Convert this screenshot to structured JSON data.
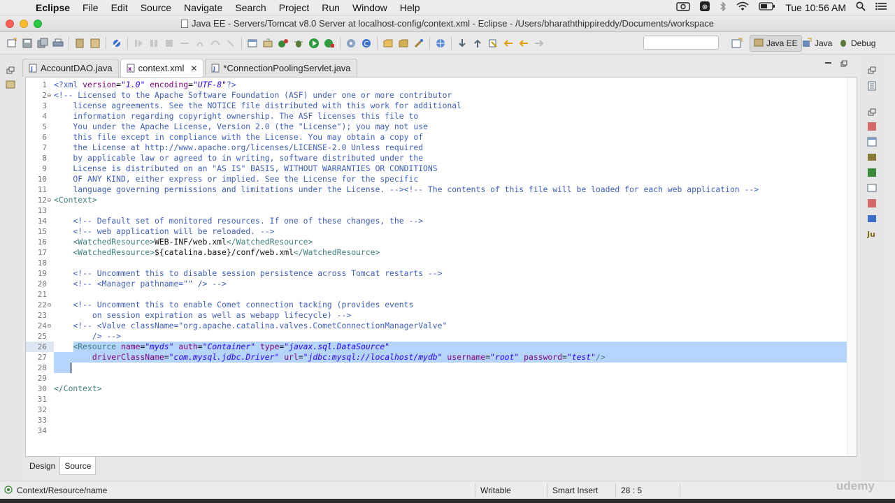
{
  "menubar": {
    "app": "Eclipse",
    "items": [
      "File",
      "Edit",
      "Source",
      "Navigate",
      "Search",
      "Project",
      "Run",
      "Window",
      "Help"
    ],
    "clock": "Tue 10:56 AM"
  },
  "window": {
    "title": "Java EE - Servers/Tomcat v8.0 Server at localhost-config/context.xml - Eclipse - /Users/bharaththippireddy/Documents/workspace"
  },
  "toolbar": {
    "quick_access_placeholder": "",
    "perspectives": [
      "Java EE",
      "Java",
      "Debug"
    ]
  },
  "tabs": [
    {
      "label": "AccountDAO.java",
      "icon": "java-file-icon",
      "active": false
    },
    {
      "label": "context.xml",
      "icon": "xml-file-icon",
      "active": true
    },
    {
      "label": "*ConnectionPoolingServlet.java",
      "icon": "java-file-icon",
      "active": false
    }
  ],
  "editor": {
    "line_numbers": [
      "1",
      "2",
      "3",
      "4",
      "5",
      "6",
      "7",
      "8",
      "9",
      "10",
      "11",
      "12",
      "13",
      "14",
      "15",
      "16",
      "17",
      "18",
      "19",
      "20",
      "21",
      "22",
      "23",
      "24",
      "25",
      "26",
      "27",
      "28",
      "29",
      "30",
      "31",
      "32",
      "33",
      "34"
    ],
    "lines": [
      "<?xml version=\"1.0\" encoding=\"UTF-8\"?>",
      "<!-- Licensed to the Apache Software Foundation (ASF) under one or more contributor",
      "    license agreements. See the NOTICE file distributed with this work for additional",
      "    information regarding copyright ownership. The ASF licenses this file to",
      "    You under the Apache License, Version 2.0 (the \"License\"); you may not use",
      "    this file except in compliance with the License. You may obtain a copy of",
      "    the License at http://www.apache.org/licenses/LICENSE-2.0 Unless required",
      "    by applicable law or agreed to in writing, software distributed under the",
      "    License is distributed on an \"AS IS\" BASIS, WITHOUT WARRANTIES OR CONDITIONS",
      "    OF ANY KIND, either express or implied. See the License for the specific",
      "    language governing permissions and limitations under the License. --><!-- The contents of this file will be loaded for each web application -->",
      "<Context>",
      "",
      "    <!-- Default set of monitored resources. If one of these changes, the -->",
      "    <!-- web application will be reloaded. -->",
      "    <WatchedResource>WEB-INF/web.xml</WatchedResource>",
      "    <WatchedResource>${catalina.base}/conf/web.xml</WatchedResource>",
      "",
      "    <!-- Uncomment this to disable session persistence across Tomcat restarts -->",
      "    <!-- <Manager pathname=\"\" /> -->",
      "",
      "    <!-- Uncomment this to enable Comet connection tacking (provides events",
      "        on session expiration as well as webapp lifecycle) -->",
      "    <!-- <Valve className=\"org.apache.catalina.valves.CometConnectionManagerValve\"",
      "        /> -->",
      "    <Resource name=\"myds\" auth=\"Container\" type=\"javax.sql.DataSource\"",
      "        driverClassName=\"com.mysql.jdbc.Driver\" url=\"jdbc:mysql://localhost/mydb\" username=\"root\" password=\"test\"/>",
      "    ",
      "",
      "</Context>",
      "",
      "",
      "",
      ""
    ]
  },
  "bottom_tabs": [
    "Design",
    "Source"
  ],
  "status": {
    "path": "Context/Resource/name",
    "mode": "Writable",
    "insert": "Smart Insert",
    "position": "28 : 5"
  },
  "watermark": "udemy"
}
